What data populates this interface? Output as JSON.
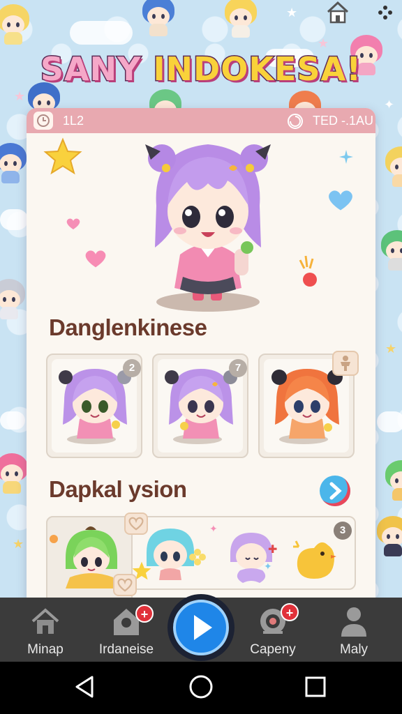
{
  "app": {
    "title": "SANY INDOKESA!",
    "title_words": [
      "SANY",
      "INDOKESA!"
    ]
  },
  "card": {
    "header": {
      "left_icon": "clock-icon",
      "left_text": "1L2",
      "right_icon": "swirl-icon",
      "right_text": "TED -.1AU"
    },
    "section1": {
      "title": "Danglenkinese",
      "tiles": [
        {
          "character": "purple-haired chibi girl",
          "badge": "2"
        },
        {
          "character": "purple-haired chibi girl",
          "badge": "7"
        },
        {
          "character": "orange-haired chibi girl",
          "badge_icon": "figure-icon"
        }
      ]
    },
    "section2": {
      "title": "Dapkal ysion",
      "next_icon": "chevron-right-icon",
      "strip_badge": "3",
      "strip_items": [
        "green-haired chibi",
        "cyan-haired chibi",
        "purple mermaid chibi",
        "yellow chick"
      ]
    }
  },
  "nav": {
    "items": [
      {
        "label": "Minap",
        "icon": "house-icon"
      },
      {
        "label": "Irdaneise",
        "icon": "home-badge-icon",
        "notification": "+"
      },
      {
        "label": "",
        "icon": "play-icon"
      },
      {
        "label": "Capeny",
        "icon": "camera-icon",
        "notification": "+"
      },
      {
        "label": "Maly",
        "icon": "person-icon"
      }
    ]
  },
  "system_bar": {
    "icons": [
      "back-icon",
      "home-circle-icon",
      "recents-icon"
    ]
  },
  "colors": {
    "header_pink": "#e8a9b0",
    "card_bg": "#fbf7f1",
    "section_text": "#6b3a2c",
    "nav_bg": "#3b3b3b",
    "play_blue": "#1f86e8",
    "notification_red": "#e0313a"
  }
}
